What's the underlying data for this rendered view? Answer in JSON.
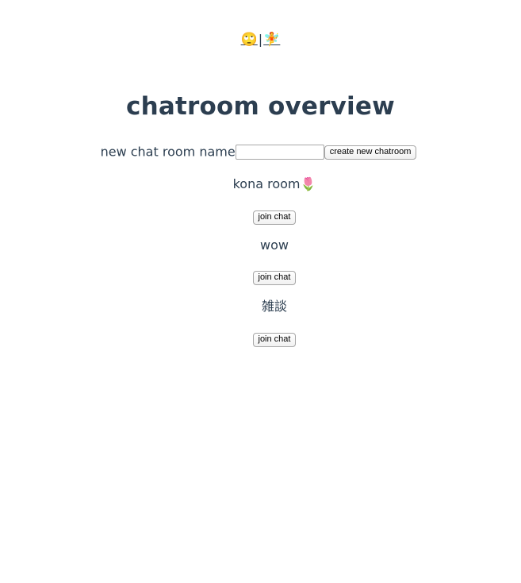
{
  "nav": {
    "link1": "🙄",
    "separator": "|",
    "link2": "🧚"
  },
  "page": {
    "title": "chatroom overview"
  },
  "create": {
    "label": "new chat room name",
    "input_value": "",
    "input_placeholder": "",
    "button_label": "create new chatroom"
  },
  "rooms": [
    {
      "name": "kona room🌷",
      "join_label": "join chat"
    },
    {
      "name": "wow",
      "join_label": "join chat"
    },
    {
      "name": "雑談",
      "join_label": "join chat"
    }
  ],
  "colors": {
    "text": "#2c3e50",
    "background": "#ffffff"
  }
}
